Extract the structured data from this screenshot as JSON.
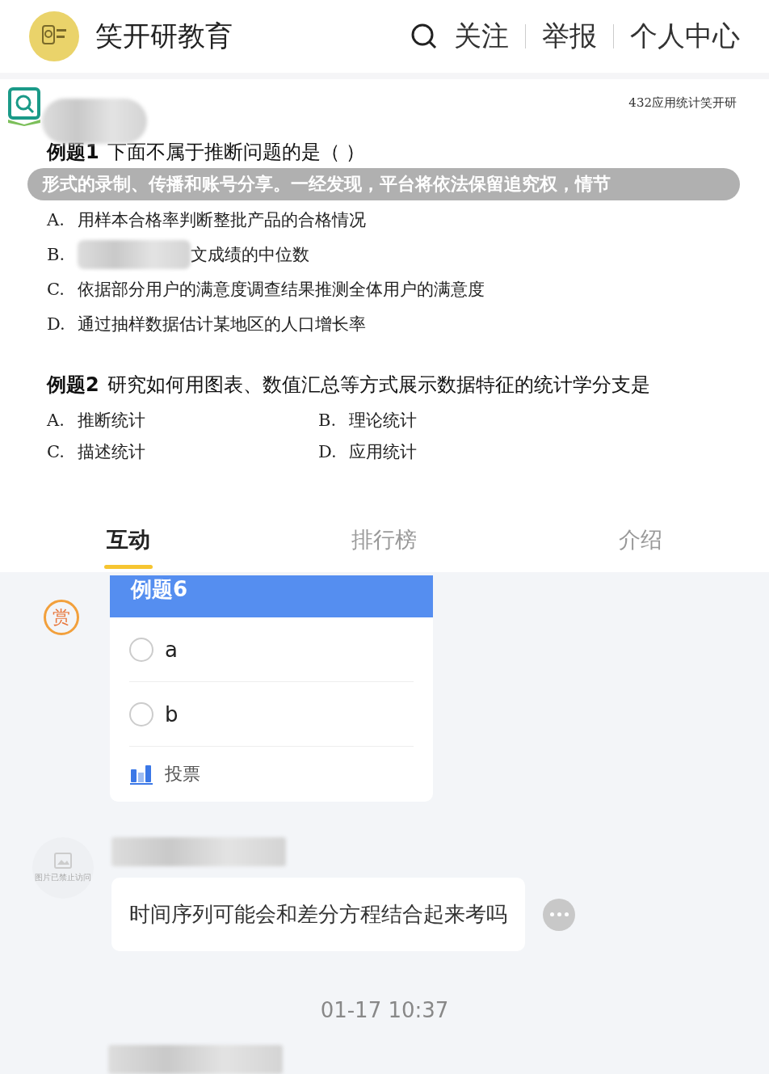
{
  "header": {
    "brand": "笑开研教育",
    "actions": [
      "关注",
      "举报",
      "个人中心"
    ]
  },
  "slide": {
    "course": "432应用统计笑开研",
    "notice": "形式的录制、传播和账号分享。一经发现，平台将依法保留追究权，情节",
    "q1": {
      "label": "例题1",
      "text": "下面不属于推断问题的是（ ）",
      "options": [
        {
          "letter": "A.",
          "text": "用样本合格率判断整批产品的合格情况",
          "blurred": false
        },
        {
          "letter": "B.",
          "text": "文成绩的中位数",
          "blurred": true
        },
        {
          "letter": "C.",
          "text": "依据部分用户的满意度调查结果推测全体用户的满意度",
          "blurred": false
        },
        {
          "letter": "D.",
          "text": "通过抽样数据估计某地区的人口增长率",
          "blurred": false
        }
      ]
    },
    "q2": {
      "label": "例题2",
      "text": "研究如何用图表、数值汇总等方式展示数据特征的统计学分支是",
      "options": [
        {
          "letter": "A.",
          "text": "推断统计"
        },
        {
          "letter": "B.",
          "text": "理论统计"
        },
        {
          "letter": "C.",
          "text": "描述统计"
        },
        {
          "letter": "D.",
          "text": "应用统计"
        }
      ]
    }
  },
  "tabs": [
    {
      "label": "互动",
      "selected": true
    },
    {
      "label": "排行榜",
      "selected": false
    },
    {
      "label": "介绍",
      "selected": false
    }
  ],
  "reward": "赏",
  "poll": {
    "title": "例题6",
    "options": [
      {
        "label": "a",
        "selected": false
      },
      {
        "label": "b",
        "selected": false
      }
    ],
    "vote": "投票"
  },
  "message": {
    "avatar_note": "图片已禁止访问",
    "text": "时间序列可能会和差分方程结合起来考吗"
  },
  "time": "01-17 10:37"
}
